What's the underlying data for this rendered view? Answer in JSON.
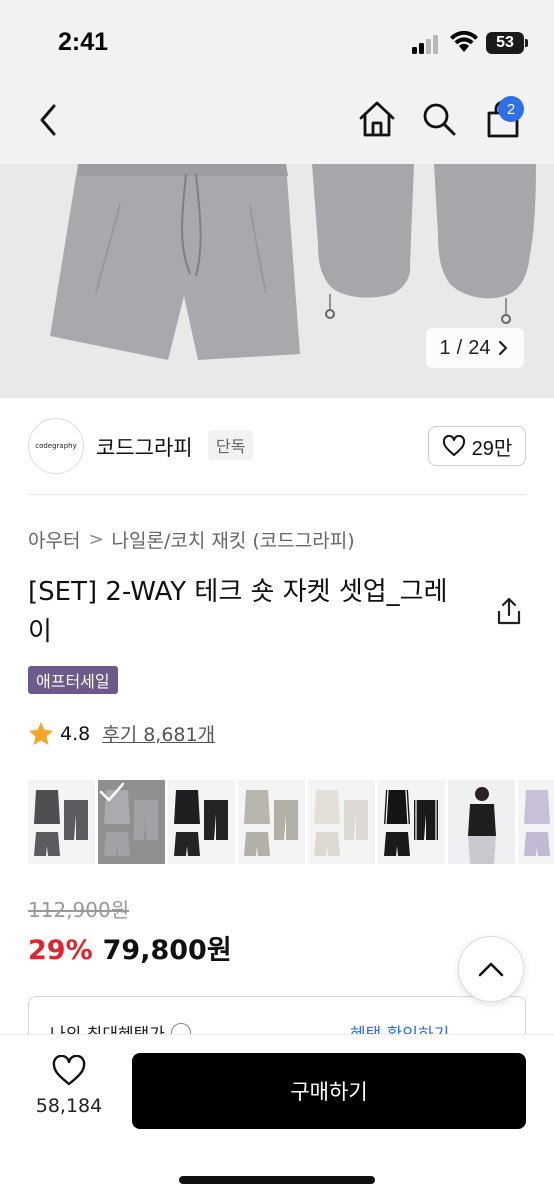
{
  "status_bar": {
    "time": "2:41",
    "battery": "53"
  },
  "nav": {
    "cart_count": "2"
  },
  "gallery": {
    "current": "1",
    "total": "24",
    "separator": "/"
  },
  "brand": {
    "logo_text": "codegraphy",
    "name": "코드그라피",
    "tag": "단독",
    "likes": "29만"
  },
  "breadcrumb": {
    "items": [
      "아우터",
      "나일론/코치 재킷 (코드그라피)"
    ],
    "separator": ">"
  },
  "product": {
    "title": "[SET] 2-WAY 테크 숏 자켓 셋업_그레이",
    "sale_badge": "애프터세일",
    "rating": "4.8",
    "review_label": "후기 8,681개",
    "original_price": "112,900원",
    "discount": "29%",
    "price": "79,800원"
  },
  "benefit": {
    "left": "나의 최대혜택가",
    "right": "혜택 확인하기"
  },
  "bottom": {
    "wish_count": "58,184",
    "buy_label": "구매하기"
  },
  "colors": {
    "accent_blue": "#2f6fe8",
    "discount_red": "#e0242b",
    "badge_purple": "#6b5b8c",
    "star": "#f5a623"
  },
  "thumbnails": [
    {
      "name": "charcoal",
      "jacket": "#4d4f53",
      "bottom": "#5a5c60"
    },
    {
      "name": "gray",
      "jacket": "#a9abae",
      "bottom": "#a0a2a5",
      "selected": true
    },
    {
      "name": "black",
      "jacket": "#1e1f21",
      "bottom": "#232426"
    },
    {
      "name": "beige-gray",
      "jacket": "#b9b6ae",
      "bottom": "#b3b0a8"
    },
    {
      "name": "ivory",
      "jacket": "#e9e7df",
      "bottom": "#e2e0d8"
    },
    {
      "name": "black-white",
      "jacket": "#151515",
      "bottom": "#1a1a1a"
    },
    {
      "name": "model",
      "jacket": "#d9d9de",
      "bottom": "#c9c9cf"
    },
    {
      "name": "lavender",
      "jacket": "#c8c0d8",
      "bottom": "#c2bad4"
    }
  ]
}
